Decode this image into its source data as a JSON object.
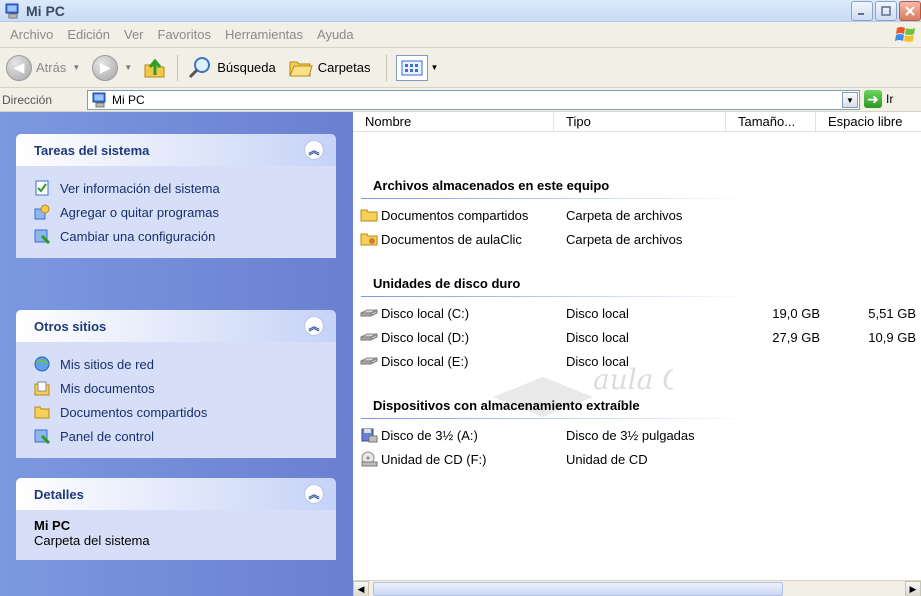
{
  "window": {
    "title": "Mi PC"
  },
  "menu": [
    "Archivo",
    "Edición",
    "Ver",
    "Favoritos",
    "Herramientas",
    "Ayuda"
  ],
  "toolbar": {
    "back_label": "Atrás",
    "search_label": "Búsqueda",
    "folders_label": "Carpetas"
  },
  "address": {
    "label": "Dirección",
    "value": "Mi PC",
    "go_label": "Ir"
  },
  "sidebar": {
    "tasks": {
      "title": "Tareas del sistema",
      "items": [
        "Ver información del sistema",
        "Agregar o quitar programas",
        "Cambiar una configuración"
      ]
    },
    "places": {
      "title": "Otros sitios",
      "items": [
        "Mis sitios de red",
        "Mis documentos",
        "Documentos compartidos",
        "Panel de control"
      ]
    },
    "details": {
      "title": "Detalles",
      "name": "Mi PC",
      "desc": "Carpeta del sistema"
    }
  },
  "columns": [
    "Nombre",
    "Tipo",
    "Tamaño...",
    "Espacio libre"
  ],
  "groups": [
    {
      "title": "Archivos almacenados en este equipo",
      "rows": [
        {
          "name": "Documentos compartidos",
          "type": "Carpeta de archivos",
          "size": "",
          "free": "",
          "icon": "folder-icon"
        },
        {
          "name": "Documentos de aulaClic",
          "type": "Carpeta de archivos",
          "size": "",
          "free": "",
          "icon": "user-folder-icon"
        }
      ]
    },
    {
      "title": "Unidades de disco duro",
      "rows": [
        {
          "name": "Disco local (C:)",
          "type": "Disco local",
          "size": "19,0 GB",
          "free": "5,51 GB",
          "icon": "hard-disk-icon"
        },
        {
          "name": "Disco local (D:)",
          "type": "Disco local",
          "size": "27,9 GB",
          "free": "10,9 GB",
          "icon": "hard-disk-icon"
        },
        {
          "name": "Disco local (E:)",
          "type": "Disco local",
          "size": "",
          "free": "",
          "icon": "hard-disk-icon"
        }
      ]
    },
    {
      "title": "Dispositivos con almacenamiento extraíble",
      "rows": [
        {
          "name": "Disco de 3½ (A:)",
          "type": "Disco de 3½ pulgadas",
          "size": "",
          "free": "",
          "icon": "floppy-icon"
        },
        {
          "name": "Unidad de CD (F:)",
          "type": "Unidad de CD",
          "size": "",
          "free": "",
          "icon": "cd-drive-icon"
        }
      ]
    }
  ],
  "watermark": "aula Clic"
}
